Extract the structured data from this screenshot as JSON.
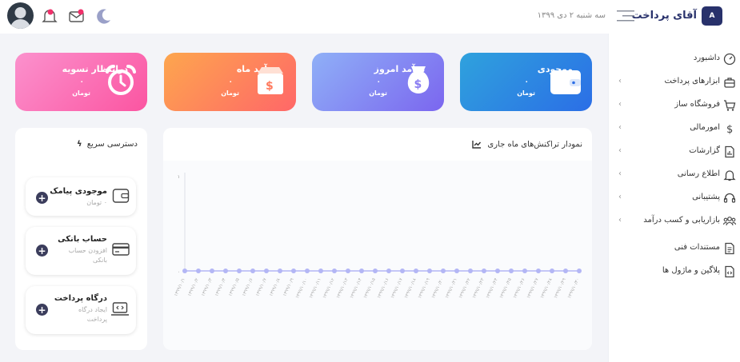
{
  "header": {
    "logo_mark": "A",
    "logo_text": "آقای پرداخت",
    "date": "سه شنبه ۲ دی ۱۳۹۹"
  },
  "sidebar": {
    "items": [
      {
        "label": "داشبورد",
        "icon": "dashboard-icon",
        "has_children": false
      },
      {
        "label": "ابزارهای پرداخت",
        "icon": "briefcase-icon",
        "has_children": true
      },
      {
        "label": "فروشگاه ساز",
        "icon": "cart-icon",
        "has_children": true
      },
      {
        "label": "امورمالی",
        "icon": "dollar-icon",
        "has_children": true
      },
      {
        "label": "گزارشات",
        "icon": "report-icon",
        "has_children": true
      },
      {
        "label": "اطلاع رسانی",
        "icon": "bell-icon",
        "has_children": true
      },
      {
        "label": "پشتیبانی",
        "icon": "support-icon",
        "has_children": true
      },
      {
        "label": "بازاریابی و کسب درآمد",
        "icon": "users-icon",
        "has_children": true
      },
      {
        "label": "مستندات فنی",
        "icon": "document-icon",
        "has_children": false
      },
      {
        "label": "پلاگین و ماژول ها",
        "icon": "plugin-icon",
        "has_children": false
      }
    ]
  },
  "stats": [
    {
      "title": "موجودی",
      "value": "۰",
      "unit": "تومان",
      "icon": "wallet-icon",
      "colors": [
        "#2f9de0",
        "#2b6ee6"
      ]
    },
    {
      "title": "درآمد امروز",
      "value": "۰",
      "unit": "تومان",
      "icon": "money-bag-icon",
      "colors": [
        "#8fa6f7",
        "#7c6cf0"
      ]
    },
    {
      "title": "درآمد ماه",
      "value": "۰",
      "unit": "تومان",
      "icon": "box-dollar-icon",
      "colors": [
        "#fda250",
        "#ff6a6a"
      ]
    },
    {
      "title": "درانتظار تسویه",
      "value": "۰",
      "unit": "تومان",
      "icon": "alarm-clock-icon",
      "colors": [
        "#fb8ccb",
        "#fa5aa4"
      ]
    }
  ],
  "chart_panel": {
    "title": "نمودار تراکنش‌های ماه جاری"
  },
  "chart_data": {
    "type": "line",
    "title": "نمودار تراکنش‌های ماه جاری",
    "y_ticks": [
      "۱",
      "۰"
    ],
    "ylim": [
      0,
      1
    ],
    "x": [
      "۱۳۹۹/۱۰/۱",
      "۱۳۹۹/۱۰/۲",
      "۱۳۹۹/۱۰/۳",
      "۱۳۹۹/۱۰/۴",
      "۱۳۹۹/۱۰/۵",
      "۱۳۹۹/۱۰/۶",
      "۱۳۹۹/۱۰/۷",
      "۱۳۹۹/۱۰/۸",
      "۱۳۹۹/۱۰/۹",
      "۱۳۹۹/۱۰/۱۰",
      "۱۳۹۹/۱۰/۱۱",
      "۱۳۹۹/۱۰/۱۲",
      "۱۳۹۹/۱۰/۱۳",
      "۱۳۹۹/۱۰/۱۴",
      "۱۳۹۹/۱۰/۱۵",
      "۱۳۹۹/۱۰/۱۶",
      "۱۳۹۹/۱۰/۱۷",
      "۱۳۹۹/۱۰/۱۸",
      "۱۳۹۹/۱۰/۱۹",
      "۱۳۹۹/۱۰/۲۰",
      "۱۳۹۹/۱۰/۲۱",
      "۱۳۹۹/۱۰/۲۲",
      "۱۳۹۹/۱۰/۲۳",
      "۱۳۹۹/۱۰/۲۴",
      "۱۳۹۹/۱۰/۲۵",
      "۱۳۹۹/۱۰/۲۶",
      "۱۳۹۹/۱۰/۲۷",
      "۱۳۹۹/۱۰/۲۸",
      "۱۳۹۹/۱۰/۲۹",
      "۱۳۹۹/۱۰/۳۰"
    ],
    "series": [
      {
        "values": [
          0,
          0,
          0,
          0,
          0,
          0,
          0,
          0,
          0,
          0,
          0,
          0,
          0,
          0,
          0,
          0,
          0,
          0,
          0,
          0,
          0,
          0,
          0,
          0,
          0,
          0,
          0,
          0,
          0,
          0
        ],
        "color": "#b3b6f5"
      }
    ],
    "grid": false
  },
  "quick_access": {
    "title": "دسترسی سریع",
    "items": [
      {
        "title": "موجودی پیامک",
        "subtitle": "۰ تومان",
        "icon": "sms-wallet-icon"
      },
      {
        "title": "حساب بانکی",
        "subtitle": "افزودن حساب بانکی",
        "icon": "bank-card-icon"
      },
      {
        "title": "درگاه پرداخت",
        "subtitle": "ایجاد درگاه پرداخت",
        "icon": "laptop-code-icon"
      }
    ]
  }
}
